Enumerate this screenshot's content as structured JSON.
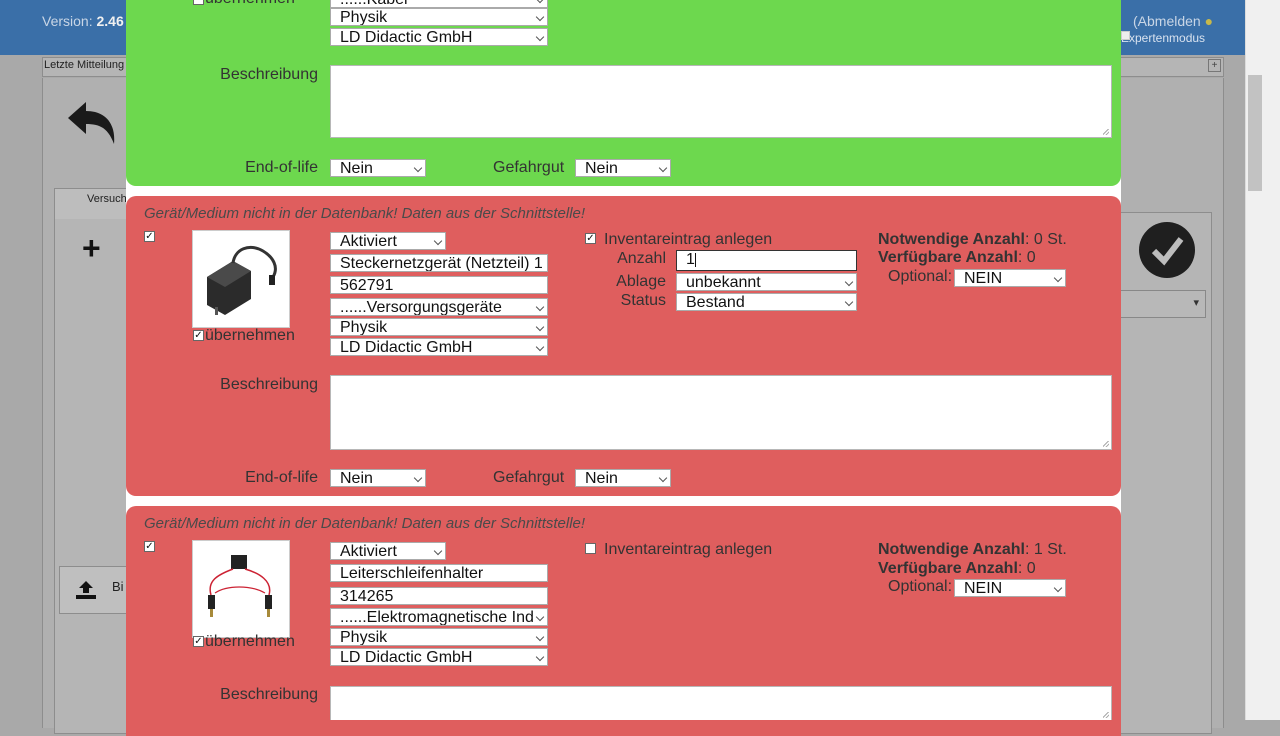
{
  "background": {
    "version_label": "Version:",
    "version_value": "2.46",
    "logout": "(Abmelden",
    "expert_mode": "Expertenmodus",
    "message_bar": "Letzte  Mitteilung",
    "tab_label": "Versuch",
    "upload_label": "Bi"
  },
  "card1": {
    "select_top_partial": "......Kabel",
    "uebernehmen_partial": "übernehmen",
    "subject": "Physik",
    "manufacturer": "LD Didactic GmbH",
    "description_label": "Beschreibung",
    "eol_label": "End-of-life",
    "eol_value": "Nein",
    "hazmat_label": "Gefahrgut",
    "hazmat_value": "Nein"
  },
  "card2": {
    "notice": "Gerät/Medium nicht in der Datenbank! Daten aus der Schnittstelle!",
    "select_checked": "✓",
    "uebernehmen": "übernehmen",
    "status_select": "Aktiviert",
    "name": "Steckernetzgerät (Netzteil) 1",
    "number": "562791",
    "category": "......Versorgungsgeräte",
    "subject": "Physik",
    "manufacturer": "LD Didactic GmbH",
    "inventory_label": "Inventareintrag anlegen",
    "inventory_checked": "✓",
    "anzahl_label": "Anzahl",
    "anzahl_value": "1",
    "ablage_label": "Ablage",
    "ablage_value": "unbekannt",
    "status_label": "Status",
    "status_value": "Bestand",
    "required_label": "Notwendige Anzahl",
    "required_value": ": 0 St.",
    "available_label": "Verfügbare Anzahl",
    "available_value": ": 0",
    "optional_label": "Optional:",
    "optional_value": "NEIN",
    "description_label": "Beschreibung",
    "eol_label": "End-of-life",
    "eol_value": "Nein",
    "hazmat_label": "Gefahrgut",
    "hazmat_value": "Nein"
  },
  "card3": {
    "notice": "Gerät/Medium nicht in der Datenbank! Daten aus der Schnittstelle!",
    "select_checked": "✓",
    "uebernehmen": "übernehmen",
    "status_select": "Aktiviert",
    "name": "Leiterschleifenhalter",
    "number": "314265",
    "category": "......Elektromagnetische Ind",
    "subject": "Physik",
    "manufacturer": "LD Didactic GmbH",
    "inventory_label": "Inventareintrag anlegen",
    "required_label": "Notwendige Anzahl",
    "required_value": ": 1 St.",
    "available_label": "Verfügbare Anzahl",
    "available_value": ": 0",
    "optional_label": "Optional:",
    "optional_value": "NEIN",
    "description_label": "Beschreibung"
  }
}
